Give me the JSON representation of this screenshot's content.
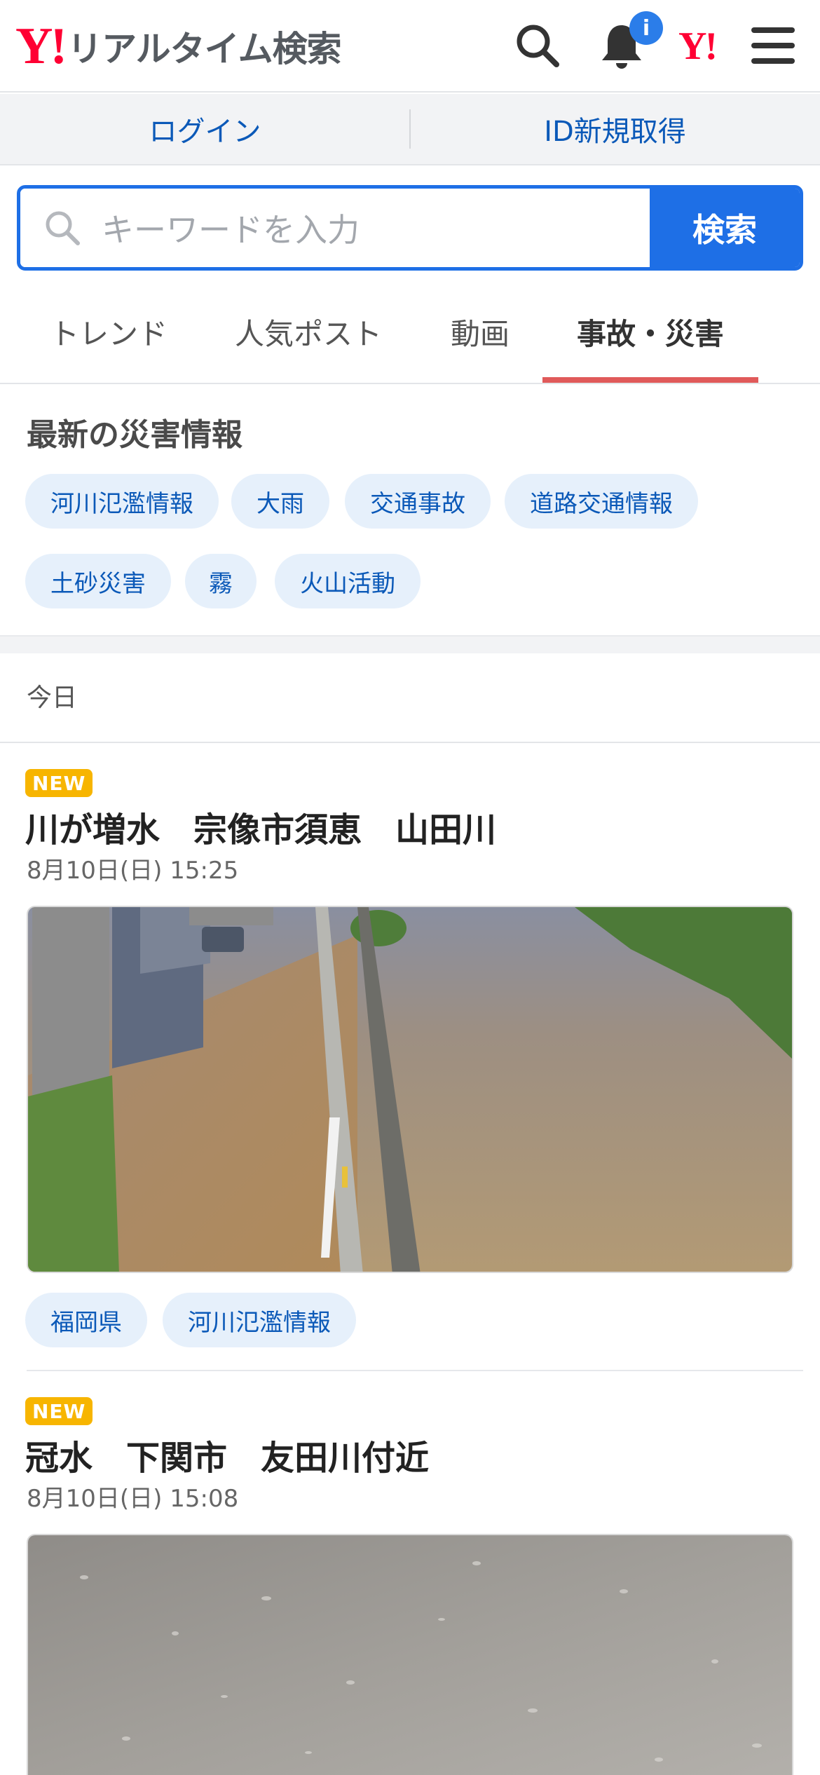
{
  "header": {
    "logo_mark": "Y!",
    "logo_text": "リアルタイム検索",
    "notification_badge": "i",
    "yj_mark": "Y!"
  },
  "login_bar": {
    "login": "ログイン",
    "register": "ID新規取得"
  },
  "search": {
    "placeholder": "キーワードを入力",
    "button": "検索"
  },
  "tabs": [
    {
      "label": "トレンド"
    },
    {
      "label": "人気ポスト"
    },
    {
      "label": "動画"
    },
    {
      "label": "事故・災害",
      "active": true
    }
  ],
  "disaster": {
    "title": "最新の災害情報",
    "chips": [
      "河川氾濫情報",
      "大雨",
      "交通事故",
      "道路交通情報",
      "土砂災害",
      "霧",
      "火山活動"
    ]
  },
  "date_header": "今日",
  "articles": [
    {
      "badge": "NEW",
      "title": "川が増水　宗像市須恵　山田川",
      "date": "8月10日(日) 15:25",
      "tags": [
        "福岡県",
        "河川氾濫情報"
      ]
    },
    {
      "badge": "NEW",
      "title": "冠水　下関市　友田川付近",
      "date": "8月10日(日) 15:08"
    }
  ],
  "colors": {
    "brand_red": "#ff0033",
    "accent_blue": "#1e6fe6",
    "link_blue": "#0b59b8",
    "chip_bg": "#e6f0fb",
    "new_badge": "#f7b500",
    "active_tab_underline": "#e05a5a"
  },
  "icons": [
    "search-icon",
    "bell-icon",
    "menu-icon"
  ]
}
